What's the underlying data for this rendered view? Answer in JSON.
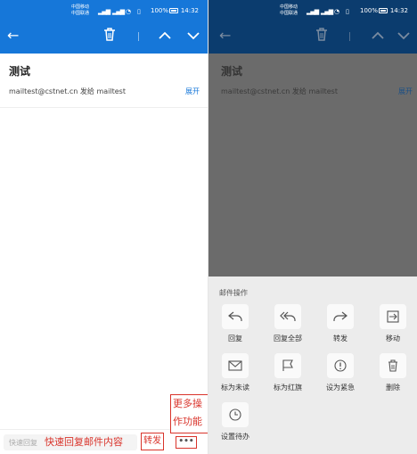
{
  "status": {
    "carrier1": "中国移动",
    "carrier2": "中国联通",
    "battery_pct": "100%",
    "time": "14:32"
  },
  "email": {
    "subject": "测试",
    "from": "mailtest@cstnet.cn",
    "sent_to_label": "发给",
    "to": "mailtest",
    "expand_label": "展开"
  },
  "bottom": {
    "quick_reply_placeholder": "快速回复",
    "forward_label": "转发",
    "more_label": "•••"
  },
  "annotations": {
    "quick_reply": "快速回复邮件内容",
    "more_functions": "更多操作功能"
  },
  "sheet": {
    "title": "邮件操作",
    "actions": [
      {
        "label": "回复",
        "icon": "reply-icon"
      },
      {
        "label": "回复全部",
        "icon": "reply-all-icon"
      },
      {
        "label": "转发",
        "icon": "forward-icon"
      },
      {
        "label": "移动",
        "icon": "move-icon"
      },
      {
        "label": "标为未读",
        "icon": "mail-unread-icon"
      },
      {
        "label": "标为红旗",
        "icon": "flag-icon"
      },
      {
        "label": "设为紧急",
        "icon": "urgent-icon"
      },
      {
        "label": "删除",
        "icon": "trash-icon"
      },
      {
        "label": "设置待办",
        "icon": "clock-icon"
      }
    ]
  },
  "colors": {
    "primary": "#1677d9",
    "annotation_red": "#d9342b",
    "dim_overlay": "#6b6b6b"
  }
}
